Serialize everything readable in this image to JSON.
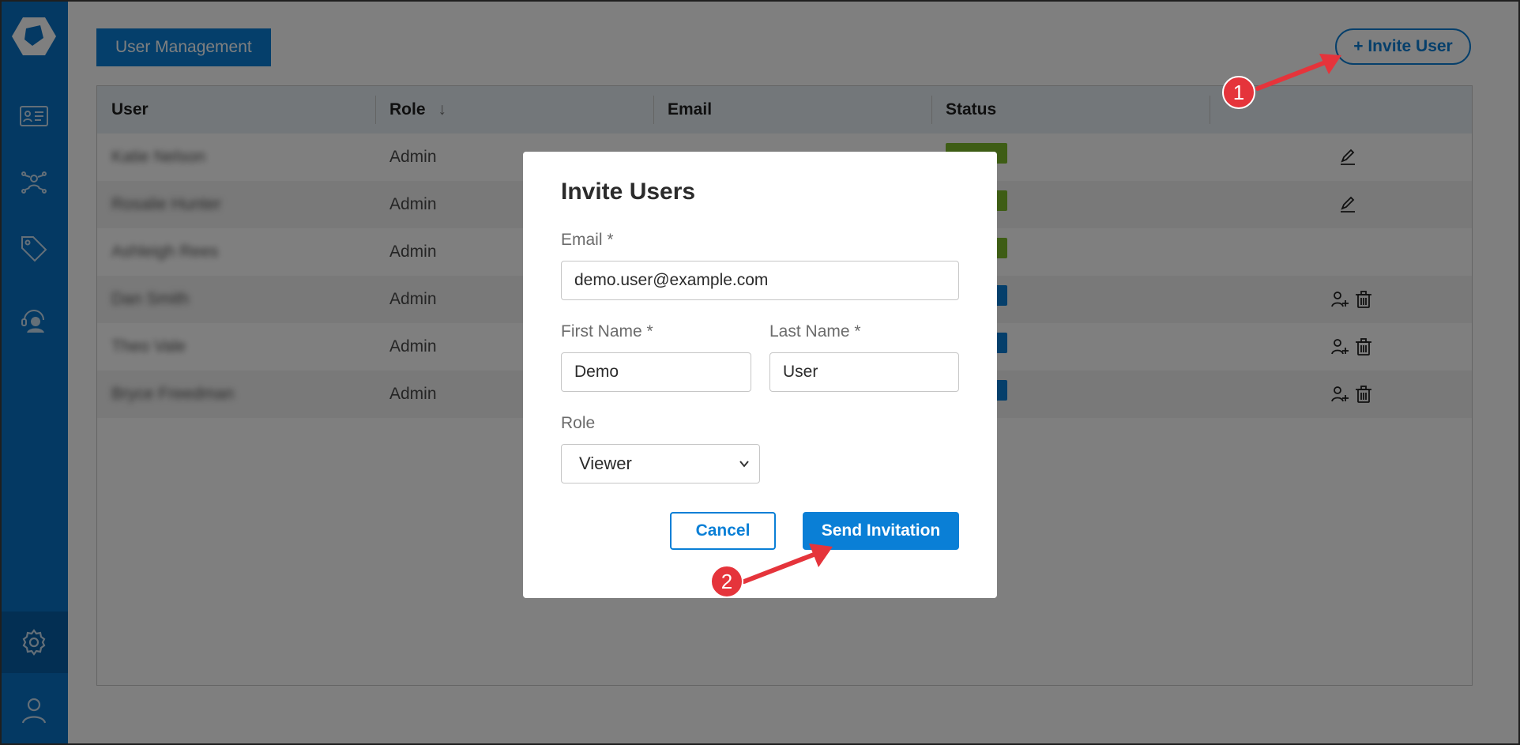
{
  "page": {
    "title": "User Management",
    "invite_button": "+ Invite User"
  },
  "table": {
    "columns": [
      "User",
      "Role",
      "Email",
      "Status"
    ],
    "sort_indicator": "↓",
    "rows": [
      {
        "user": "Katie Nelson",
        "role": "Admin",
        "status_color": "#7cbb2b",
        "actions": "edit"
      },
      {
        "user": "Rosalie Hunter",
        "role": "Admin",
        "status_color": "#7cbb2b",
        "actions": "edit"
      },
      {
        "user": "Ashleigh Rees",
        "role": "Admin",
        "status_color": "#7cbb2b",
        "actions": "none"
      },
      {
        "user": "Dan Smith",
        "role": "Admin",
        "status_color": "#0a7fd6",
        "actions": "resend-delete"
      },
      {
        "user": "Theo Vale",
        "role": "Admin",
        "status_color": "#0a7fd6",
        "actions": "resend-delete"
      },
      {
        "user": "Bryce Freedman",
        "role": "Admin",
        "status_color": "#0a7fd6",
        "actions": "resend-delete"
      }
    ]
  },
  "modal": {
    "title": "Invite Users",
    "email_label": "Email *",
    "email_value": "demo.user@example.com",
    "first_name_label": "First Name *",
    "first_name_value": "Demo",
    "last_name_label": "Last Name *",
    "last_name_value": "User",
    "role_label": "Role",
    "role_value": "Viewer",
    "cancel_label": "Cancel",
    "send_label": "Send Invitation"
  },
  "annotations": {
    "callout_1": "1",
    "callout_2": "2"
  },
  "colors": {
    "sidebar": "#0873c7",
    "accent": "#0a7fd6",
    "active_status": "#7cbb2b",
    "invited_status": "#0a7fd6",
    "annotation": "#e5343b"
  },
  "icons": {
    "sidebar": [
      "app-logo-icon",
      "contact-card-icon",
      "network-users-icon",
      "tag-icon",
      "support-agent-icon",
      "gear-icon",
      "user-profile-icon"
    ],
    "row_actions": [
      "pencil-edit-icon",
      "resend-invite-user-icon",
      "trash-icon"
    ]
  }
}
